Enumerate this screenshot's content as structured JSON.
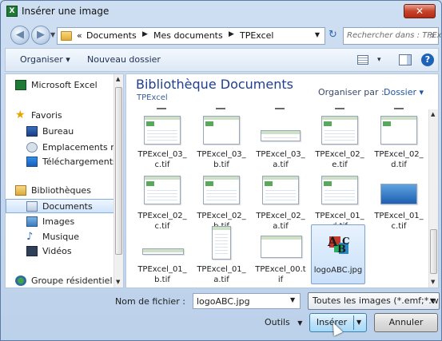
{
  "window": {
    "title": "Insérer une image",
    "close_label": "✕",
    "app_icon_glyph": "X"
  },
  "nav": {
    "back_glyph": "◀",
    "forward_glyph": "▶",
    "history_glyph": "▼",
    "breadcrumb_prefix": "«",
    "breadcrumb": [
      "Documents",
      "Mes documents",
      "TPExcel"
    ],
    "crumb_separator": "▶",
    "address_dropdown": "▼",
    "refresh_glyph": "↻",
    "search_placeholder": "Rechercher dans : TPExc...",
    "search_icon": "⌕"
  },
  "toolbar": {
    "organize": "Organiser",
    "organize_caret": "▾",
    "new_folder": "Nouveau dossier",
    "view_caret": "▾",
    "help": "?"
  },
  "sidebar": {
    "items": [
      {
        "label": "Microsoft Excel",
        "icon": "excel-icon"
      },
      {
        "label": "Favoris",
        "icon": "star-icon"
      },
      {
        "label": "Bureau",
        "icon": "desktop-icon"
      },
      {
        "label": "Emplacements ré",
        "icon": "recent-places-icon"
      },
      {
        "label": "Téléchargements",
        "icon": "downloads-icon"
      },
      {
        "label": "Bibliothèques",
        "icon": "libraries-icon"
      },
      {
        "label": "Documents",
        "icon": "documents-icon"
      },
      {
        "label": "Images",
        "icon": "pictures-icon"
      },
      {
        "label": "Musique",
        "icon": "music-icon"
      },
      {
        "label": "Vidéos",
        "icon": "videos-icon"
      },
      {
        "label": "Groupe résidentiel",
        "icon": "homegroup-icon"
      }
    ],
    "selected": "Documents",
    "star_glyph": "★",
    "music_glyph": "♪",
    "scroll_up": "▲",
    "scroll_down": "▼"
  },
  "content": {
    "library_title": "Bibliothèque Documents",
    "library_subtitle": "TPExcel",
    "arrange_label": "Organiser par :",
    "arrange_value": "Dossier",
    "arrange_caret": "▾",
    "files": [
      {
        "name": "TPExcel_03_c.tif"
      },
      {
        "name": "TPExcel_03_b.tif"
      },
      {
        "name": "TPExcel_03_a.tif"
      },
      {
        "name": "TPExcel_02_e.tif"
      },
      {
        "name": "TPExcel_02_d.tif"
      },
      {
        "name": "TPExcel_02_c.tif"
      },
      {
        "name": "TPExcel_02_b.tif"
      },
      {
        "name": "TPExcel_02_a.tif"
      },
      {
        "name": "TPExcel_01_d.tif"
      },
      {
        "name": "TPExcel_01_c.tif"
      },
      {
        "name": "TPExcel_01_b.tif"
      },
      {
        "name": "TPExcel_01_a.tif"
      },
      {
        "name": "TPExcel_00.tif"
      },
      {
        "name": "logoABC.jpg"
      }
    ],
    "selected_file": "logoABC.jpg",
    "scroll_up": "▲",
    "scroll_down": "▼"
  },
  "bottom": {
    "filename_label": "Nom de fichier :",
    "filename_value": "logoABC.jpg",
    "filename_dropdown": "▼",
    "filetype_value": "Toutes les images (*.emf;*.w",
    "filetype_dropdown": "▼",
    "tools_label": "Outils",
    "tools_caret": "▼",
    "insert_label": "Insérer",
    "insert_caret": "▼",
    "cancel_label": "Annuler"
  },
  "colors": {
    "title_blue": "#1f3f8f",
    "selection": "#c9e0fa",
    "close_red": "#c7432a"
  }
}
